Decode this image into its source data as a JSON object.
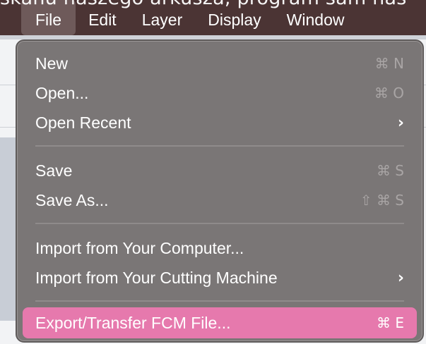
{
  "background": {
    "doc_text": "skanu naszego arkusza, program sam nas"
  },
  "menubar": {
    "items": [
      {
        "label": "File",
        "active": true
      },
      {
        "label": "Edit"
      },
      {
        "label": "Layer"
      },
      {
        "label": "Display"
      },
      {
        "label": "Window"
      }
    ]
  },
  "menu": {
    "new": {
      "label": "New",
      "shortcut": "⌘ N"
    },
    "open": {
      "label": "Open...",
      "shortcut": "⌘ O"
    },
    "open_recent": {
      "label": "Open Recent",
      "chevron": "›"
    },
    "save": {
      "label": "Save",
      "shortcut": "⌘ S"
    },
    "save_as": {
      "label": "Save As...",
      "shortcut": "⇧ ⌘ S"
    },
    "import_computer": {
      "label": "Import from Your Computer..."
    },
    "import_machine": {
      "label": "Import from Your Cutting Machine",
      "chevron": "›"
    },
    "export": {
      "label": "Export/Transfer FCM File...",
      "shortcut": "⌘ E"
    }
  },
  "colors": {
    "menubar": "#4b3434",
    "menu_bg": "#7a7676",
    "highlight": "#e679ad"
  }
}
